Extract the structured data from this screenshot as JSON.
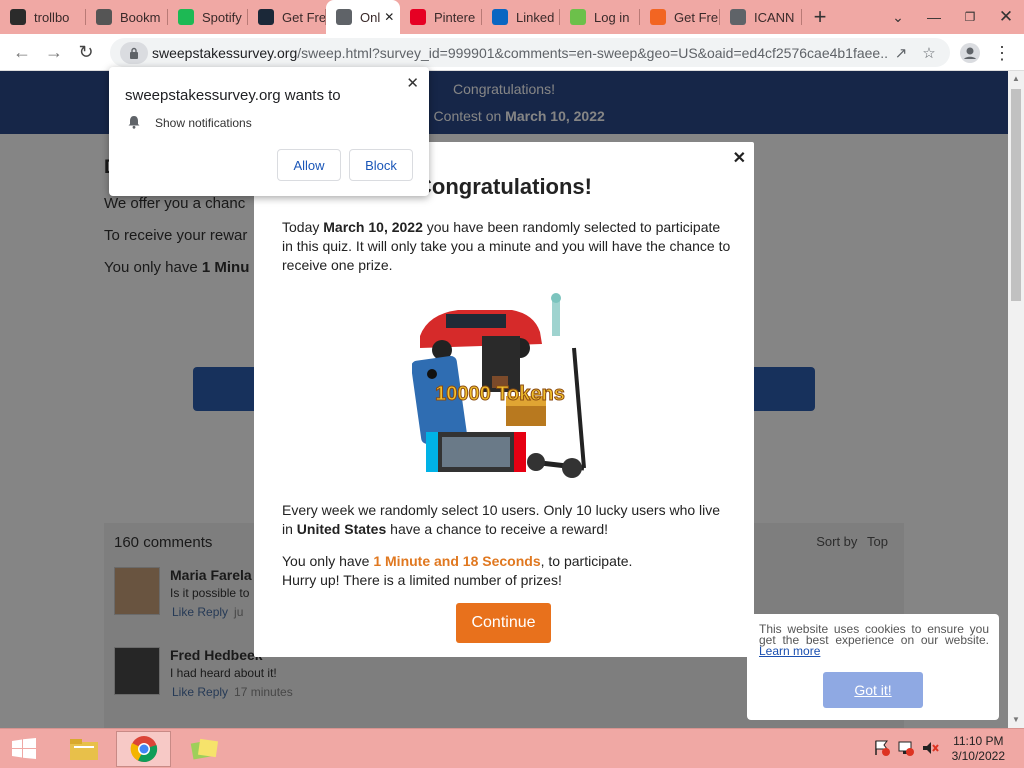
{
  "browser": {
    "tabs": [
      {
        "label": "trollbo",
        "fav_color": "#2b2b2b",
        "icon": "trollbox-icon"
      },
      {
        "label": "Bookm",
        "fav_color": "#555555",
        "icon": "star-icon"
      },
      {
        "label": "Spotify",
        "fav_color": "#1db954",
        "icon": "spotify-icon"
      },
      {
        "label": "Get Fre",
        "fav_color": "#1b2838",
        "icon": "steam-icon"
      },
      {
        "label": "Onl",
        "fav_color": "#5f6368",
        "icon": "page-icon"
      },
      {
        "label": "Pintere",
        "fav_color": "#e60023",
        "icon": "pinterest-icon"
      },
      {
        "label": "Linked",
        "fav_color": "#0a66c2",
        "icon": "linkedin-icon"
      },
      {
        "label": "Log in",
        "fav_color": "#6cc04a",
        "icon": "x-logo-icon"
      },
      {
        "label": "Get Fre",
        "fav_color": "#f26522",
        "icon": "f-logo-icon"
      },
      {
        "label": "ICANN",
        "fav_color": "#5f6368",
        "icon": "icann-icon"
      }
    ],
    "active_tab": 4,
    "url_domain": "sweepstakessurvey.org",
    "url_path": "/sweep.html?survey_id=999901&comments=en-sweep&geo=US&oaid=ed4cf2576cae4b1faee..."
  },
  "hero": {
    "line1": "Congratulations!",
    "line2_prefix": "onal Contest on ",
    "line2_date": "March 10, 2022"
  },
  "background": {
    "heading_frag": "D",
    "line1": "We offer you a chanc",
    "line2": "To receive your rewar",
    "line3_prefix": "You only have ",
    "line3_bold": "1 Minu"
  },
  "comments": {
    "count": "160 comments",
    "sort_label": "Sort by",
    "sort_value": "Top",
    "items": [
      {
        "name": "Maria Farela",
        "text": "Is it possible to",
        "actions": "Like Reply",
        "time": "ju"
      },
      {
        "name": "Fred Hedbeek",
        "text": "I had heard about it!",
        "actions": "Like Reply",
        "time": "17 minutes"
      }
    ]
  },
  "modal": {
    "title": "Congratulations!",
    "p1_a": "Today ",
    "p1_date": "March 10, 2022",
    "p1_b": " you have been randomly selected to participate in this quiz. It will only take you a minute and you will have the chance to receive one prize.",
    "p2_a": "Every week we randomly select 10 users. Only 10 lucky users who live in ",
    "p2_country": "United States",
    "p2_b": " have a chance to receive a reward!",
    "p3_a": "You only have ",
    "p3_time": "1 Minute and 18 Seconds",
    "p3_b": ", to participate.",
    "p4": "Hurry up! There is a limited number of prizes!",
    "tokens_text": "10000 Tokens",
    "continue_label": "Continue"
  },
  "notification": {
    "title": "sweepstakessurvey.org wants to",
    "item": "Show notifications",
    "allow": "Allow",
    "block": "Block"
  },
  "cookie": {
    "text": "This website uses cookies to ensure you get the best experience on our website.",
    "learn_more": "Learn more",
    "button": "Got it!"
  },
  "taskbar": {
    "time": "11:10 PM",
    "date": "3/10/2022"
  },
  "colors": {
    "accent_orange": "#e8711c",
    "hero_blue": "#2b4a8a",
    "chrome_pink": "#f0a8a4"
  }
}
